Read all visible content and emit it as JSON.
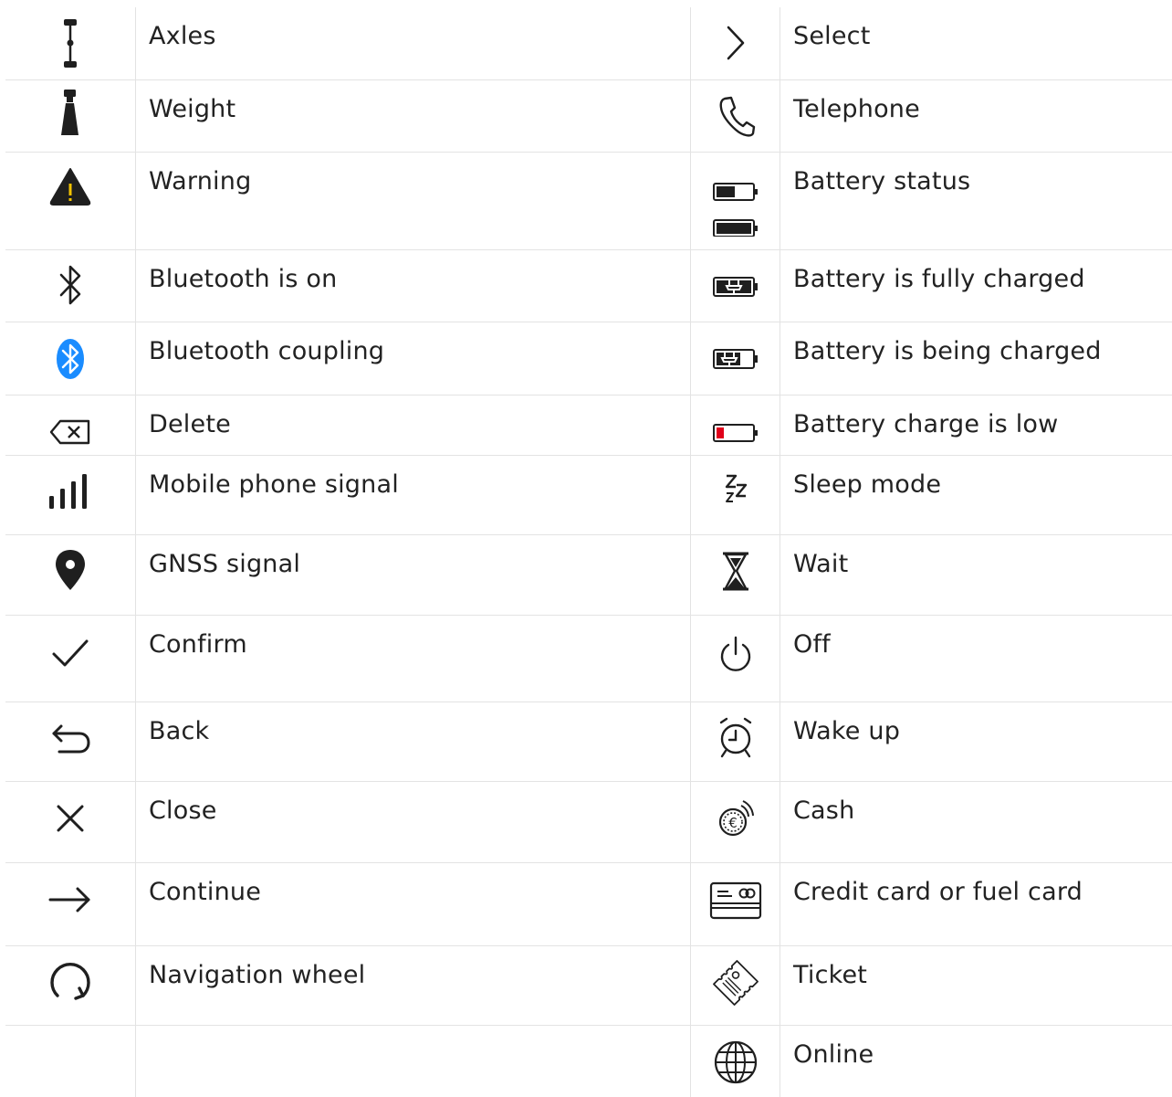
{
  "rows": [
    {
      "left": {
        "icon": "axles-icon",
        "label": "Axles"
      },
      "right": {
        "icon": "chevron-right-icon",
        "label": "Select"
      }
    },
    {
      "left": {
        "icon": "weight-icon",
        "label": "Weight"
      },
      "right": {
        "icon": "telephone-icon",
        "label": "Telephone"
      }
    },
    {
      "left": {
        "icon": "warning-icon",
        "label": "Warning"
      },
      "right": {
        "icon": "battery-status-icon",
        "label": "Battery status"
      }
    },
    {
      "left": {
        "icon": "bluetooth-icon",
        "label": "Bluetooth is on"
      },
      "right": {
        "icon": "battery-full-charged-icon",
        "label": "Battery is fully charged"
      }
    },
    {
      "left": {
        "icon": "bluetooth-coupling-icon",
        "label": "Bluetooth coupling"
      },
      "right": {
        "icon": "battery-charging-icon",
        "label": "Battery is being charged"
      }
    },
    {
      "left": {
        "icon": "delete-icon",
        "label": "Delete"
      },
      "right": {
        "icon": "battery-low-icon",
        "label": "Battery charge is low"
      }
    },
    {
      "left": {
        "icon": "signal-icon",
        "label": "Mobile phone signal"
      },
      "right": {
        "icon": "sleep-icon",
        "label": "Sleep mode"
      }
    },
    {
      "left": {
        "icon": "gnss-pin-icon",
        "label": "GNSS signal"
      },
      "right": {
        "icon": "hourglass-icon",
        "label": "Wait"
      }
    },
    {
      "left": {
        "icon": "checkmark-icon",
        "label": "Confirm"
      },
      "right": {
        "icon": "power-icon",
        "label": "Off"
      }
    },
    {
      "left": {
        "icon": "back-arrow-icon",
        "label": "Back"
      },
      "right": {
        "icon": "alarm-clock-icon",
        "label": "Wake up"
      }
    },
    {
      "left": {
        "icon": "close-icon",
        "label": "Close"
      },
      "right": {
        "icon": "cash-icon",
        "label": "Cash"
      }
    },
    {
      "left": {
        "icon": "arrow-right-icon",
        "label": "Continue"
      },
      "right": {
        "icon": "credit-card-icon",
        "label": "Credit card or fuel card"
      }
    },
    {
      "left": {
        "icon": "navigation-wheel-icon",
        "label": "Navigation wheel"
      },
      "right": {
        "icon": "ticket-icon",
        "label": "Ticket"
      }
    },
    {
      "left": {
        "icon": "",
        "label": ""
      },
      "right": {
        "icon": "globe-icon",
        "label": "Online"
      }
    }
  ],
  "colors": {
    "icon": "#1f1f1f",
    "divider": "#e3e3e3",
    "warning": "#f2c200",
    "bluetooth": "#1a8cff",
    "battery_low": "#e0001a"
  }
}
